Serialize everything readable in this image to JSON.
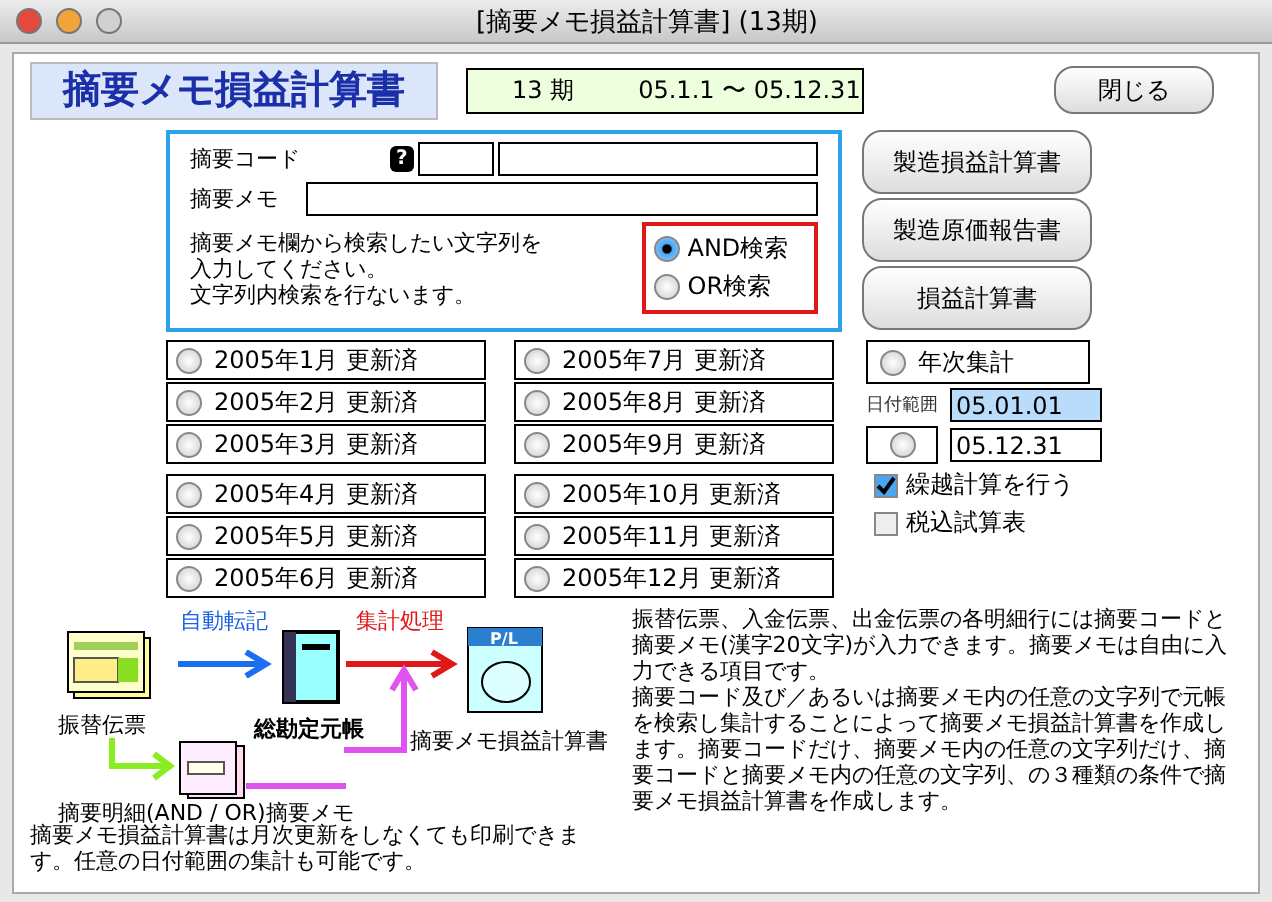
{
  "window": {
    "title": "[摘要メモ損益計算書]  (13期)"
  },
  "heading": "摘要メモ損益計算書",
  "period": {
    "term": "13 期",
    "range": "05.1.1 〜 05.12.31"
  },
  "close_button": "閉じる",
  "search": {
    "code_label": "摘要コード",
    "help_icon": "?",
    "memo_label": "摘要メモ",
    "hint": [
      "摘要メモ欄から検索したい文字列を",
      "入力してください。",
      "文字列内検索を行ないます。"
    ],
    "modes": [
      {
        "label": "AND検索",
        "selected": true
      },
      {
        "label": "OR検索",
        "selected": false
      }
    ]
  },
  "reports": [
    "製造損益計算書",
    "製造原価報告書",
    "損益計算書"
  ],
  "months": [
    {
      "label": "2005年1月 更新済",
      "selected": false
    },
    {
      "label": "2005年2月 更新済",
      "selected": false
    },
    {
      "label": "2005年3月 更新済",
      "selected": false
    },
    {
      "label": "2005年4月 更新済",
      "selected": false
    },
    {
      "label": "2005年5月 更新済",
      "selected": false
    },
    {
      "label": "2005年6月 更新済",
      "selected": false
    },
    {
      "label": "2005年7月 更新済",
      "selected": false
    },
    {
      "label": "2005年8月 更新済",
      "selected": false
    },
    {
      "label": "2005年9月 更新済",
      "selected": false
    },
    {
      "label": "2005年10月 更新済",
      "selected": false
    },
    {
      "label": "2005年11月 更新済",
      "selected": false
    },
    {
      "label": "2005年12月 更新済",
      "selected": false
    }
  ],
  "annual": {
    "label": "年次集計",
    "selected": false
  },
  "date_range": {
    "label": "日付範囲",
    "selected": false,
    "from": "05.01.01",
    "to": "05.12.31"
  },
  "options": [
    {
      "label": "繰越計算を行う",
      "checked": true
    },
    {
      "label": "税込試算表",
      "checked": false
    }
  ],
  "diagram": {
    "auto_post": "自動転記",
    "aggregate": "集計処理",
    "voucher": "振替伝票",
    "ledger": "総勘定元帳",
    "report_icon_text": "P/L",
    "report": "摘要メモ損益計算書",
    "memo": "摘要明細(AND / OR)摘要メモ"
  },
  "note_left": "摘要メモ損益計算書は月次更新をしなくても印刷できます。任意の日付範囲の集計も可能です。",
  "note_right": [
    "振替伝票、入金伝票、出金伝票の各明細行には摘要コードと摘要メモ(漢字20文字)が入力できます。摘要メモは自由に入力できる項目です。",
    "摘要コード及び／あるいは摘要メモ内の任意の文字列で元帳を検索し集計することによって摘要メモ損益計算書を作成します。摘要コードだけ、摘要メモ内の任意の文字列だけ、摘要コードと摘要メモ内の任意の文字列、の３種類の条件で摘要メモ損益計算書を作成します。"
  ]
}
